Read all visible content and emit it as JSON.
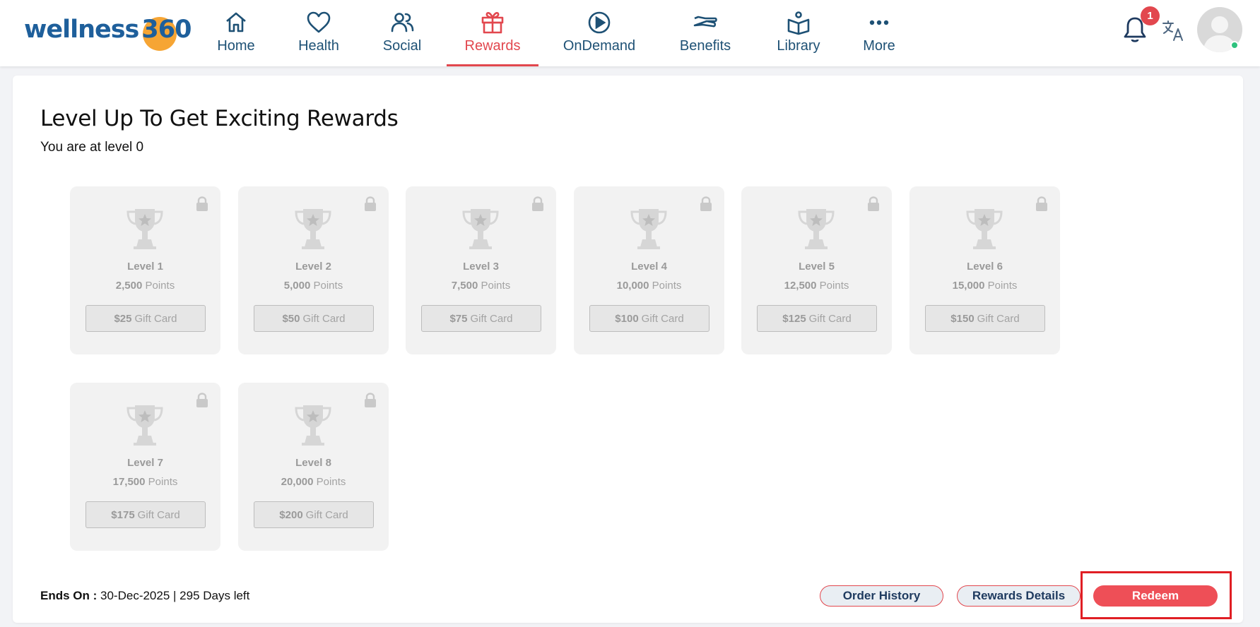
{
  "nav": {
    "logo_word": "wellness",
    "logo_number": "360",
    "items": [
      {
        "label": "Home",
        "icon": "home-icon"
      },
      {
        "label": "Health",
        "icon": "heart-icon"
      },
      {
        "label": "Social",
        "icon": "people-icon"
      },
      {
        "label": "Rewards",
        "icon": "gift-icon",
        "active": true
      },
      {
        "label": "OnDemand",
        "icon": "play-circle-icon"
      },
      {
        "label": "Benefits",
        "icon": "hand-icon"
      },
      {
        "label": "Library",
        "icon": "book-icon"
      },
      {
        "label": "More",
        "icon": "more-dots-icon"
      }
    ],
    "notification_count": "1",
    "active_color": "#e2474e",
    "text_color": "#1e5175"
  },
  "page": {
    "title": "Level Up To Get Exciting Rewards",
    "level_note": "You are at level 0"
  },
  "levels": [
    {
      "name": "Level 1",
      "points": "2,500",
      "points_unit": "Points",
      "amount": "$25",
      "reward": "Gift Card",
      "locked": true
    },
    {
      "name": "Level 2",
      "points": "5,000",
      "points_unit": "Points",
      "amount": "$50",
      "reward": "Gift Card",
      "locked": true
    },
    {
      "name": "Level 3",
      "points": "7,500",
      "points_unit": "Points",
      "amount": "$75",
      "reward": "Gift Card",
      "locked": true
    },
    {
      "name": "Level 4",
      "points": "10,000",
      "points_unit": "Points",
      "amount": "$100",
      "reward": "Gift Card",
      "locked": true
    },
    {
      "name": "Level 5",
      "points": "12,500",
      "points_unit": "Points",
      "amount": "$125",
      "reward": "Gift Card",
      "locked": true
    },
    {
      "name": "Level 6",
      "points": "15,000",
      "points_unit": "Points",
      "amount": "$150",
      "reward": "Gift Card",
      "locked": true
    },
    {
      "name": "Level 7",
      "points": "17,500",
      "points_unit": "Points",
      "amount": "$175",
      "reward": "Gift Card",
      "locked": true
    },
    {
      "name": "Level 8",
      "points": "20,000",
      "points_unit": "Points",
      "amount": "$200",
      "reward": "Gift Card",
      "locked": true
    }
  ],
  "footer": {
    "ends_label": "Ends On :",
    "ends_value": "30-Dec-2025 | 295 Days left",
    "order_history_label": "Order History",
    "rewards_details_label": "Rewards Details",
    "redeem_label": "Redeem",
    "redeem_color": "#ee4f57"
  }
}
